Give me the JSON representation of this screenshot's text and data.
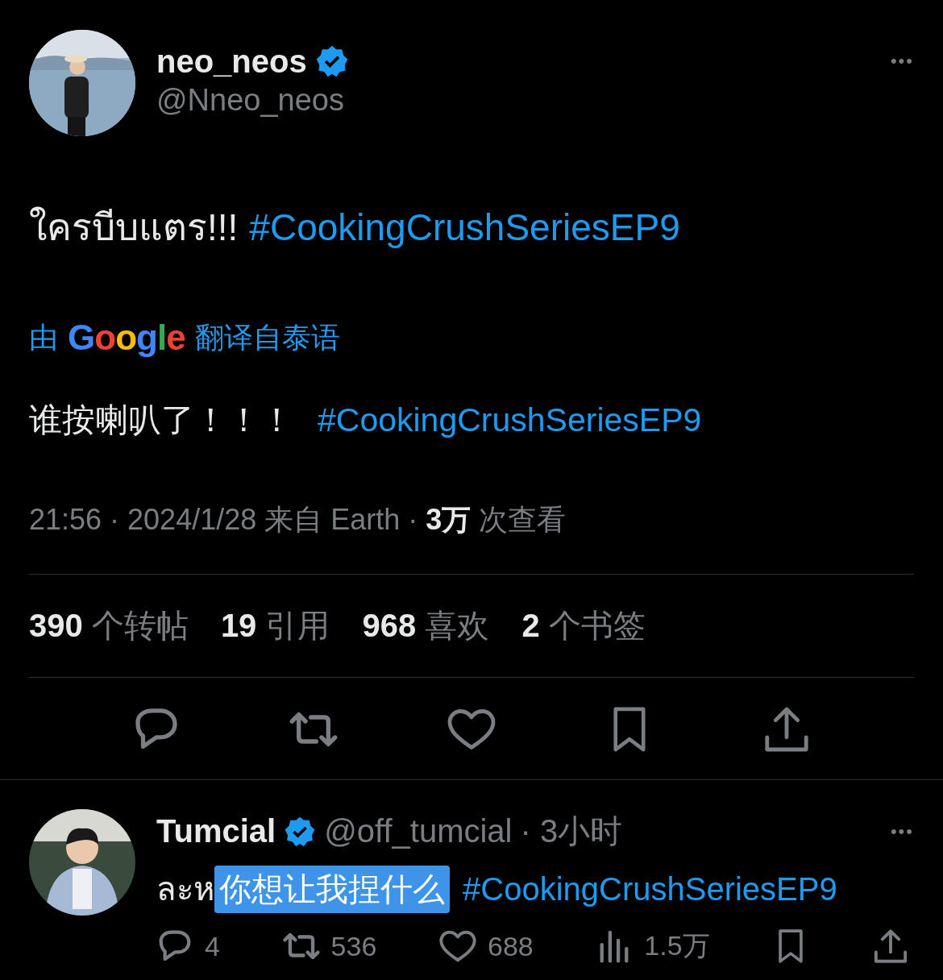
{
  "tweet": {
    "author": {
      "name": "neo_neos",
      "handle": "@Nneo_neos",
      "verified": true
    },
    "more": "•••",
    "text": "ใครบีบแตร!!!",
    "hashtag": "#CookingCrushSeriesEP9",
    "translation": {
      "prefix": "由",
      "brand": "Google",
      "suffix": "翻译自泰语",
      "text": "谁按喇叭了！！！",
      "hashtag": "#CookingCrushSeriesEP9"
    },
    "meta": {
      "time": "21:56 · 2024/1/28 来自 Earth ·",
      "views": "3万",
      "views_label": "次查看"
    },
    "stats": [
      "**390** 个转帖",
      "**19** 引用",
      "**968** 喜欢",
      "**2** 个书签"
    ],
    "actions": [
      {
        "kind": "reply"
      },
      {
        "kind": "repost"
      },
      {
        "kind": "like"
      },
      {
        "kind": "bookmark"
      },
      {
        "kind": "share"
      }
    ]
  },
  "reply": {
    "name": "Tumcial",
    "verified": true,
    "handle": "@off_tumcial",
    "time": "· 3小时",
    "more": "•••",
    "text_start": "ละห",
    "selection_bubble": "你想让我捏什么",
    "hashtag": "#CookingCrushSeriesEP9",
    "actions": [
      {
        "kind": "reply",
        "count": "4"
      },
      {
        "kind": "repost",
        "count": "536"
      },
      {
        "kind": "like",
        "count": "688"
      },
      {
        "kind": "views",
        "count": "1.5万"
      },
      {
        "kind": "bookmark"
      },
      {
        "kind": "share"
      }
    ]
  }
}
